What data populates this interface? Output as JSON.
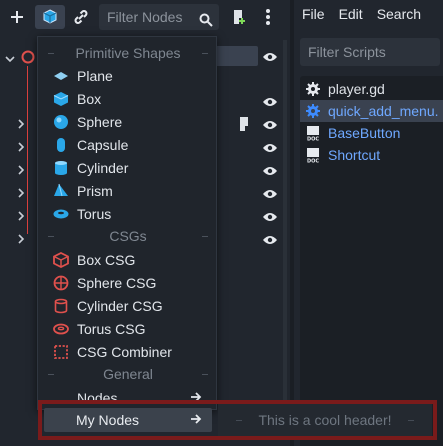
{
  "scene_dock": {
    "filter_placeholder": "Filter Nodes",
    "tree_rows": [
      {
        "visible": true
      },
      {
        "visible": true
      },
      {
        "visible": true
      },
      {
        "visible": true
      },
      {
        "visible": true
      },
      {
        "visible": true
      },
      {
        "visible": true
      },
      {
        "visible": true
      }
    ]
  },
  "popup": {
    "sections": {
      "primitive": "Primitive Shapes",
      "csgs": "CSGs",
      "general": "General"
    },
    "primitive_items": [
      "Plane",
      "Box",
      "Sphere",
      "Capsule",
      "Cylinder",
      "Prism",
      "Torus"
    ],
    "csg_items": [
      "Box CSG",
      "Sphere CSG",
      "Cylinder CSG",
      "Torus CSG",
      "CSG Combiner"
    ],
    "general_items": [
      "Nodes"
    ],
    "highlighted_item": "My Nodes",
    "custom_header": "This is a cool header!"
  },
  "script_dock": {
    "menu": [
      "File",
      "Edit",
      "Search"
    ],
    "filter_placeholder": "Filter Scripts",
    "scripts": [
      {
        "name": "player.gd",
        "icon": "gear-icon",
        "selected": false,
        "link": false
      },
      {
        "name": "quick_add_menu.",
        "icon": "gear-icon",
        "selected": true,
        "link": true
      },
      {
        "name": "BaseButton",
        "icon": "doc-icon",
        "selected": false,
        "link": true
      },
      {
        "name": "Shortcut",
        "icon": "doc-icon",
        "selected": false,
        "link": true
      }
    ]
  },
  "colors": {
    "accent_blue": "#6fa8ff",
    "csg_red": "#e0514d",
    "primitive_blue": "#2aa7e8",
    "highlight_frame": "#7a1b1b"
  }
}
